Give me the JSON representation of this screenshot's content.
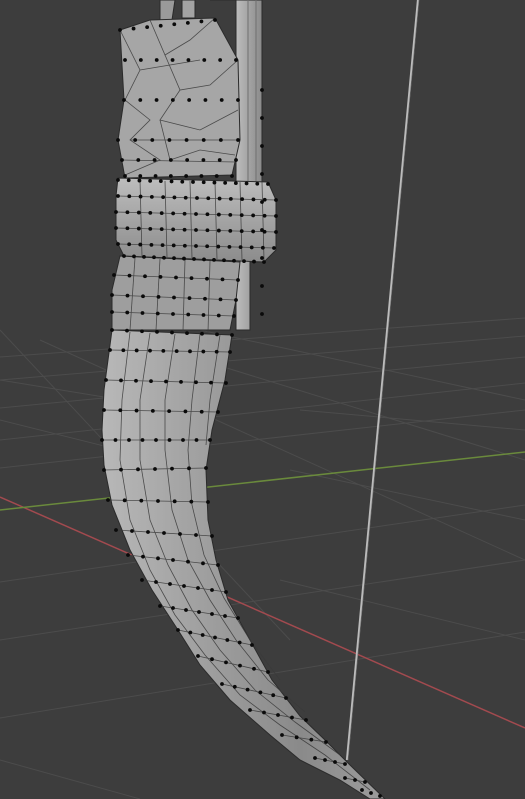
{
  "viewport": {
    "mode": "edit-mode-mesh",
    "background_color": "#3d3d3d",
    "grid_color": "#505050",
    "x_axis_color": "#a24a4f",
    "y_axis_color": "#6a8a3c",
    "mesh_face_color": "#9a9a9a",
    "mesh_edge_color": "#2a2a2a",
    "vertex_color": "#0a0a0a",
    "stick_color": "#b0b0b0"
  }
}
